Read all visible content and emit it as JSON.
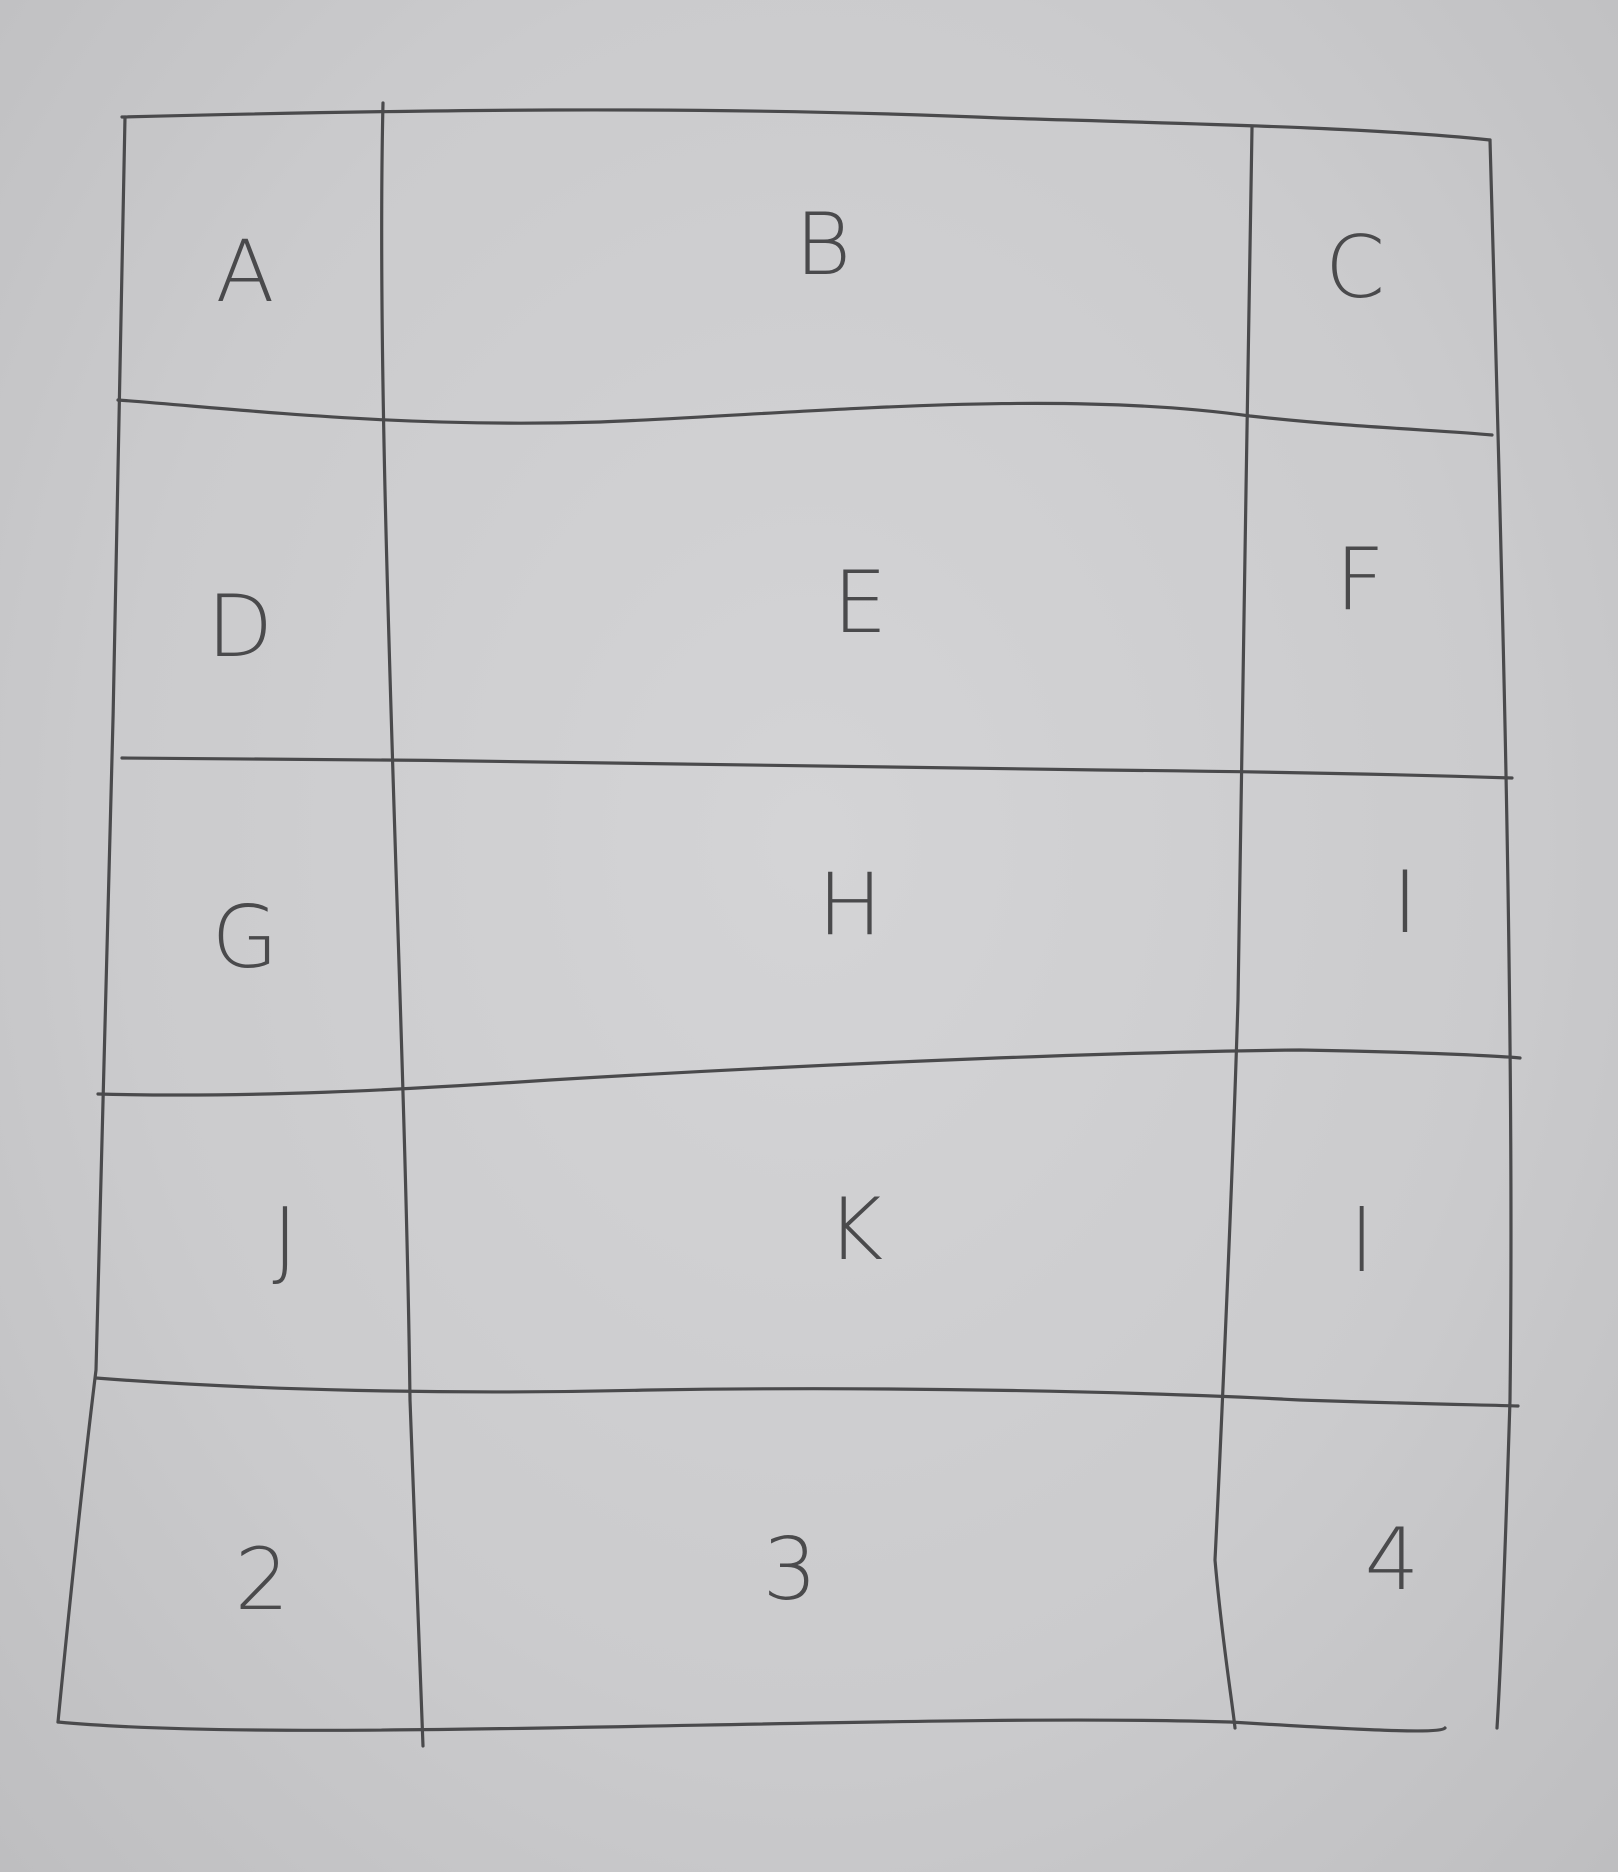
{
  "table": {
    "rows": [
      [
        "A",
        "B",
        "C"
      ],
      [
        "D",
        "E",
        "F"
      ],
      [
        "G",
        "H",
        "I"
      ],
      [
        "J",
        "K",
        "l"
      ],
      [
        "2",
        "3",
        "4"
      ]
    ]
  },
  "colors": {
    "paper": "#cfcfd1",
    "pencil": "#4a4a4c"
  }
}
